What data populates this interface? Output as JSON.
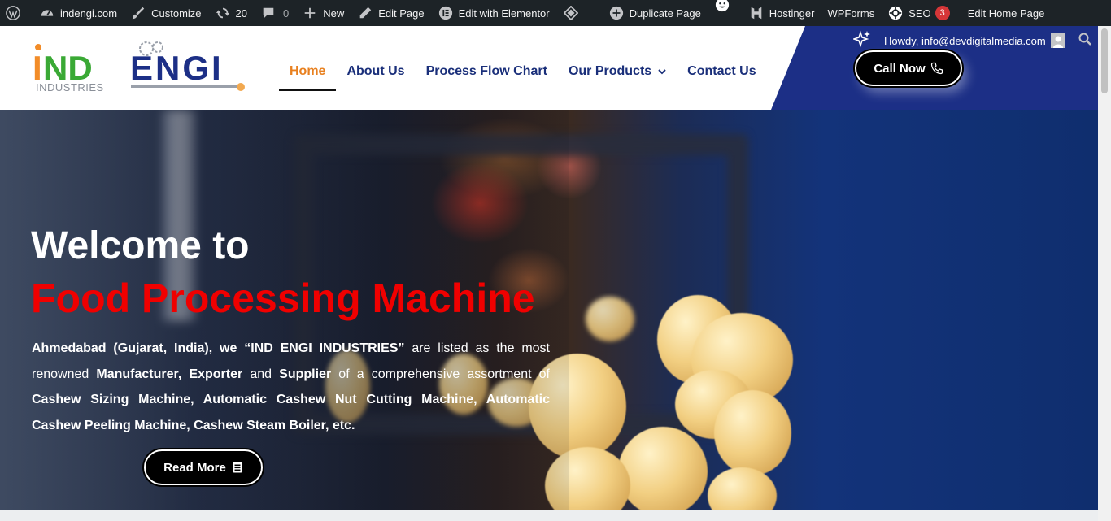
{
  "adminbar": {
    "site_name": "indengi.com",
    "customize": "Customize",
    "updates_count": "20",
    "comments_count": "0",
    "new_label": "New",
    "edit_page": "Edit Page",
    "edit_elementor": "Edit with Elementor",
    "duplicate_page": "Duplicate Page",
    "hostinger": "Hostinger",
    "wpforms": "WPForms",
    "seo": "SEO",
    "seo_badge": "3",
    "edit_home": "Edit Home Page"
  },
  "header": {
    "logo_text_left": "IND",
    "logo_text_right": "ENGI",
    "logo_sub": "INDUSTRIES",
    "nav": [
      {
        "label": "Home"
      },
      {
        "label": "About Us"
      },
      {
        "label": "Process Flow Chart"
      },
      {
        "label": "Our Products"
      },
      {
        "label": "Contact Us"
      }
    ],
    "howdy": "Howdy, info@devdigitalmedia.com",
    "call_label": "Call Now"
  },
  "hero": {
    "welcome": "Welcome to",
    "title": "Food Processing Machine",
    "desc": {
      "p1": "Ahmedabad (Gujarat, India), we ",
      "company": "“IND ENGI INDUSTRIES”",
      "p2": " are listed as the most renowned ",
      "manufacturer": "Manufacturer,",
      "p3": " ",
      "exporter": "Exporter",
      "p4": " and ",
      "supplier": "Supplier",
      "p5": " of a comprehensive assortment of ",
      "products": "Cashew Sizing Machine, Automatic Cashew Nut Cutting Machine, Automatic Cashew Peeling Machine, Cashew Steam Boiler, etc."
    },
    "read_more": "Read More"
  },
  "colors": {
    "adminbar_bg": "#1d2327",
    "nav_text": "#1a2f7a",
    "nav_active": "#e8801f",
    "panel_blue": "#1c2f86",
    "title_red": "#f00000",
    "logo_orange": "#f28c28",
    "logo_green": "#3aa935"
  }
}
